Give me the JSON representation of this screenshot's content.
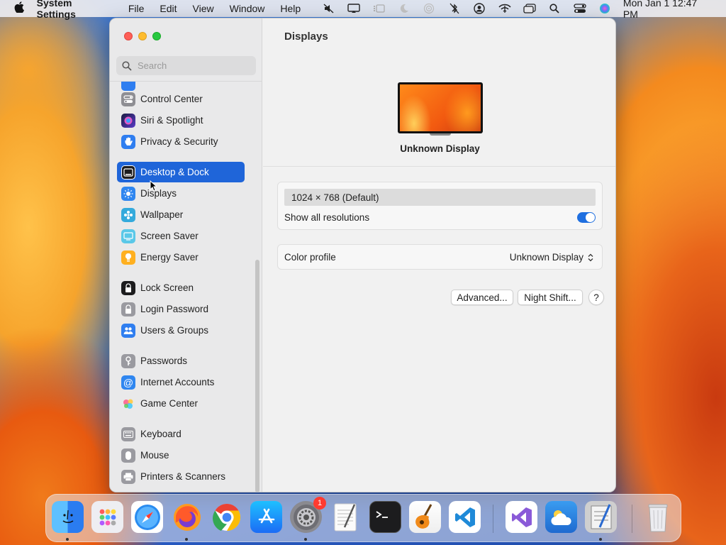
{
  "menubar": {
    "apple": "",
    "app_name": "System Settings",
    "menus": [
      "File",
      "Edit",
      "View",
      "Window",
      "Help"
    ],
    "clock": "Mon Jan 1  12:47 PM"
  },
  "sidebar": {
    "search_placeholder": "Search",
    "items": [
      {
        "label": "Control Center",
        "icon": "control-center-icon",
        "color": "#8e8e93"
      },
      {
        "label": "Siri & Spotlight",
        "icon": "siri-icon",
        "color": "#5a3cc8"
      },
      {
        "label": "Privacy & Security",
        "icon": "hand-icon",
        "color": "#2f7ef0"
      },
      {
        "label": "Desktop & Dock",
        "icon": "desktop-dock-icon",
        "color": "#1c1c1e"
      },
      {
        "label": "Displays",
        "icon": "displays-icon",
        "color": "#2f86f0"
      },
      {
        "label": "Wallpaper",
        "icon": "wallpaper-icon",
        "color": "#34aadc"
      },
      {
        "label": "Screen Saver",
        "icon": "screen-saver-icon",
        "color": "#5ac8e8"
      },
      {
        "label": "Energy Saver",
        "icon": "energy-saver-icon",
        "color": "#ffb020"
      },
      {
        "label": "Lock Screen",
        "icon": "lock-screen-icon",
        "color": "#1c1c1e"
      },
      {
        "label": "Login Password",
        "icon": "login-password-icon",
        "color": "#9a9aa0"
      },
      {
        "label": "Users & Groups",
        "icon": "users-groups-icon",
        "color": "#2f7ef0"
      },
      {
        "label": "Passwords",
        "icon": "passwords-icon",
        "color": "#9a9aa0"
      },
      {
        "label": "Internet Accounts",
        "icon": "internet-accounts-icon",
        "color": "#2f86f0"
      },
      {
        "label": "Game Center",
        "icon": "game-center-icon",
        "color": "#ffffff"
      },
      {
        "label": "Keyboard",
        "icon": "keyboard-icon",
        "color": "#9a9aa0"
      },
      {
        "label": "Mouse",
        "icon": "mouse-icon",
        "color": "#9a9aa0"
      },
      {
        "label": "Printers & Scanners",
        "icon": "printers-scanners-icon",
        "color": "#9a9aa0"
      }
    ],
    "selected": "Desktop & Dock"
  },
  "content": {
    "title": "Displays",
    "display_name": "Unknown Display",
    "resolution": "1024 × 768 (Default)",
    "show_all_resolutions_label": "Show all resolutions",
    "show_all_resolutions_on": true,
    "color_profile_label": "Color profile",
    "color_profile_value": "Unknown Display",
    "buttons": {
      "advanced": "Advanced...",
      "night_shift": "Night Shift...",
      "help": "?"
    }
  },
  "dock": {
    "apps": [
      {
        "name": "Finder",
        "icon": "finder-icon",
        "color": "#3b9cf0",
        "running": true
      },
      {
        "name": "Launchpad",
        "icon": "launchpad-icon",
        "color": "#e9e9ee",
        "running": false
      },
      {
        "name": "Safari",
        "icon": "safari-icon",
        "color": "#2a8cf0",
        "running": false
      },
      {
        "name": "Firefox",
        "icon": "firefox-icon",
        "color": "#ff7a1a",
        "running": true
      },
      {
        "name": "Chrome",
        "icon": "chrome-icon",
        "color": "#ffffff",
        "running": false
      },
      {
        "name": "App Store",
        "icon": "app-store-icon",
        "color": "#1c8cf5",
        "running": false
      },
      {
        "name": "System Settings",
        "icon": "system-settings-icon",
        "color": "#8a8a90",
        "running": true,
        "badge": "1"
      },
      {
        "name": "TextEdit",
        "icon": "textedit-icon",
        "color": "#f4f4f4",
        "running": false
      },
      {
        "name": "Terminal",
        "icon": "terminal-icon",
        "color": "#1c1c1e",
        "running": false
      },
      {
        "name": "GarageBand",
        "icon": "garageband-icon",
        "color": "#f08a1a",
        "running": false
      },
      {
        "name": "VS Code",
        "icon": "vscode-icon",
        "color": "#ffffff",
        "running": false
      },
      {
        "name": "Visual Studio",
        "icon": "visual-studio-icon",
        "color": "#ffffff",
        "running": false
      },
      {
        "name": "Weather",
        "icon": "weather-icon",
        "color": "#2f86f0",
        "running": false
      },
      {
        "name": "Script Editor",
        "icon": "script-editor-icon",
        "color": "#dcdcdc",
        "running": true
      },
      {
        "name": "Trash",
        "icon": "trash-icon",
        "color": "#e6e6ea",
        "running": false
      }
    ]
  }
}
